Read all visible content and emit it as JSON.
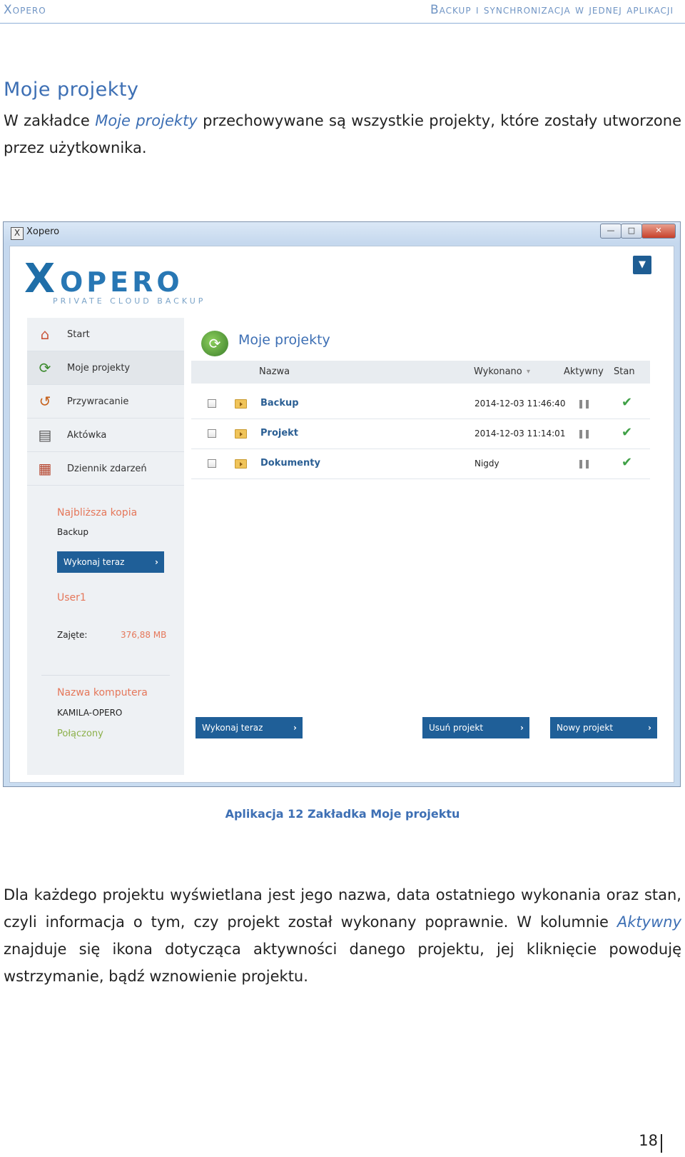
{
  "header": {
    "brand": "Xopero",
    "tagline": "Backup i synchronizacja w jednej aplikacji"
  },
  "section_title": "Moje projekty",
  "intro": {
    "before": "W zakładce ",
    "emph": "Moje projekty",
    "after": " przechowywane są wszystkie projekty, które zostały utworzone przez użytkownika."
  },
  "app": {
    "window_title": "Xopero",
    "window_buttons": {
      "minimize": "—",
      "maximize": "□",
      "close": "✕"
    },
    "logo": {
      "mark": "X",
      "word": "OPERO",
      "sub": "PRIVATE CLOUD BACKUP"
    },
    "nav": [
      {
        "label": "Start",
        "icon": "home-icon",
        "glyph": "⌂",
        "color": "#c9553a"
      },
      {
        "label": "Moje projekty",
        "icon": "projects-icon",
        "glyph": "⟳",
        "color": "#3c8a2e"
      },
      {
        "label": "Przywracanie",
        "icon": "restore-icon",
        "glyph": "↺",
        "color": "#c6621e"
      },
      {
        "label": "Aktówka",
        "icon": "briefcase-icon",
        "glyph": "▤",
        "color": "#555555"
      },
      {
        "label": "Dziennik zdarzeń",
        "icon": "log-icon",
        "glyph": "▦",
        "color": "#b5452e"
      }
    ],
    "sidebar": {
      "next_backup_label": "Najbliższa kopia",
      "next_backup_value": "Backup",
      "run_now": "Wykonaj teraz",
      "user": "User1",
      "used_label": "Zajęte:",
      "used_value": "376,88 MB",
      "computer_label": "Nazwa komputera",
      "computer_value": "KAMILA-OPERO",
      "status": "Połączony"
    },
    "main_title": "Moje projekty",
    "table": {
      "headers": {
        "name": "Nazwa",
        "done": "Wykonano",
        "sort": "▾",
        "active": "Aktywny",
        "state": "Stan"
      },
      "rows": [
        {
          "name": "Backup",
          "date": "2014-12-03 11:46:40",
          "pause": "❚❚",
          "check": "✔"
        },
        {
          "name": "Projekt",
          "date": "2014-12-03 11:14:01",
          "pause": "❚❚",
          "check": "✔"
        },
        {
          "name": "Dokumenty",
          "date": "Nigdy",
          "pause": "❚❚",
          "check": "✔"
        }
      ]
    },
    "buttons": {
      "run_now": "Wykonaj teraz",
      "delete": "Usuń projekt",
      "new": "Nowy projekt",
      "chevron": "›"
    }
  },
  "caption": "Aplikacja 12 Zakładka Moje projektu",
  "body": {
    "p1": "Dla każdego projektu wyświetlana jest jego nazwa, data ostatniego wykonania oraz stan, czyli informacja o tym, czy projekt został wykonany poprawnie. W kolumnie ",
    "p1_emph": "Aktywny",
    "p1_after": " znajduje się ikona dotycząca aktywności danego projektu, jej kliknięcie powoduję wstrzymanie, bądź wznowienie projektu."
  },
  "page_number": "18"
}
